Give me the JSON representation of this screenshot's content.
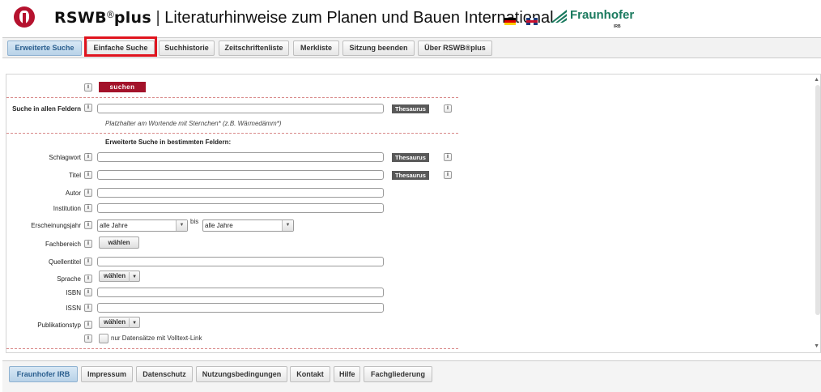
{
  "header": {
    "brand_rswb": "RSWB",
    "brand_reg": "®",
    "brand_plus": "plus",
    "brand_sep": " | ",
    "brand_title": "Literaturhinweise zum Planen und Bauen International",
    "fraunhofer": "Fraunhofer",
    "irb": "IRB"
  },
  "nav": {
    "tabs": [
      "Erweiterte Suche",
      "Einfache Suche",
      "Suchhistorie",
      "Zeitschriftenliste",
      "Merkliste",
      "Sitzung beenden",
      "Über RSWB®plus"
    ],
    "active_tab": "Erweiterte Suche",
    "highlighted_tab": "Einfache Suche"
  },
  "form": {
    "info_glyph": "i",
    "search_button": "suchen",
    "all_fields_label": "Suche in allen Feldern",
    "thesaurus": "Thesaurus",
    "hint": "Platzhalter am Wortende mit Sternchen* (z.B. Wärmedämm*)",
    "section_title": "Erweiterte Suche in bestimmten Feldern:",
    "fields": {
      "schlagwort": "Schlagwort",
      "titel": "Titel",
      "autor": "Autor",
      "institution": "Institution",
      "erscheinungsjahr": "Erscheinungsjahr",
      "fachbereich": "Fachbereich",
      "quellentitel": "Quellentitel",
      "sprache": "Sprache",
      "isbn": "ISBN",
      "issn": "ISSN",
      "publikationstyp": "Publikationstyp"
    },
    "year_from": "alle Jahre",
    "year_to": "alle Jahre",
    "bis": "bis",
    "waehlen": "wählen",
    "volltext": "nur Datensätze mit Volltext-Link"
  },
  "footer": {
    "tabs": [
      "Fraunhofer IRB",
      "Impressum",
      "Datenschutz",
      "Nutzungsbedingungen",
      "Kontakt",
      "Hilfe",
      "Fachgliederung"
    ],
    "active_tab": "Fraunhofer IRB"
  },
  "colors": {
    "brand_red": "#b5122e",
    "button_red": "#a3122a",
    "highlight_red": "#e0141e",
    "fraunhofer_green": "#1a7a5e",
    "active_tab_blue": "#2b5f8f"
  }
}
